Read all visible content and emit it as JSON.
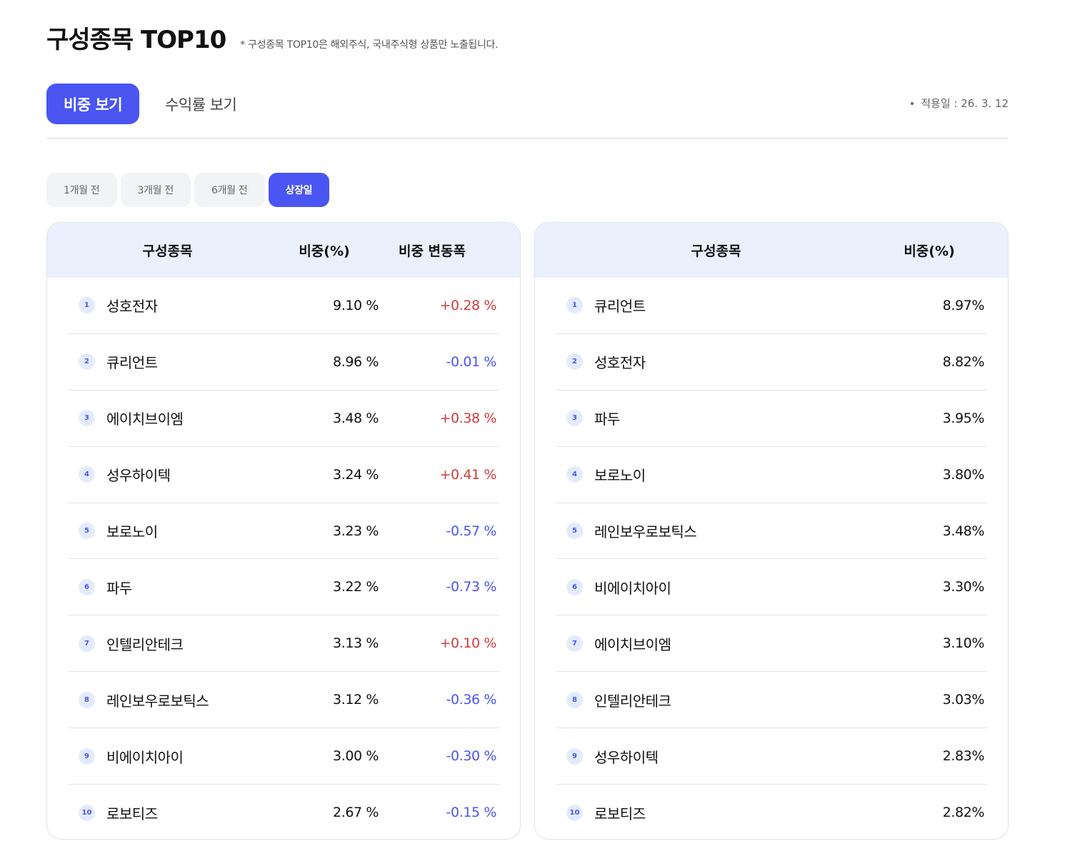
{
  "header": {
    "title": "구성종목 TOP10",
    "note": "* 구성종목 TOP10은 해외주식, 국내주식형 상품만 노출됩니다."
  },
  "view_tabs": [
    {
      "label": "비중 보기",
      "active": true
    },
    {
      "label": "수익률 보기",
      "active": false
    }
  ],
  "apply_date": "적용일 : 26. 3. 12",
  "period_tabs": [
    {
      "label": "1개월 전",
      "active": false
    },
    {
      "label": "3개월 전",
      "active": false
    },
    {
      "label": "6개월 전",
      "active": false
    },
    {
      "label": "상장일",
      "active": true
    }
  ],
  "left_table": {
    "headers": [
      "구성종목",
      "비중(%)",
      "비중 변동폭"
    ],
    "rows": [
      {
        "rank": "1",
        "name": "성호전자",
        "weight": "9.10 %",
        "change": "+0.28 %",
        "dir": "up"
      },
      {
        "rank": "2",
        "name": "큐리언트",
        "weight": "8.96 %",
        "change": "-0.01 %",
        "dir": "down"
      },
      {
        "rank": "3",
        "name": "에이치브이엠",
        "weight": "3.48 %",
        "change": "+0.38 %",
        "dir": "up"
      },
      {
        "rank": "4",
        "name": "성우하이텍",
        "weight": "3.24 %",
        "change": "+0.41 %",
        "dir": "up"
      },
      {
        "rank": "5",
        "name": "보로노이",
        "weight": "3.23 %",
        "change": "-0.57 %",
        "dir": "down"
      },
      {
        "rank": "6",
        "name": "파두",
        "weight": "3.22 %",
        "change": "-0.73 %",
        "dir": "down"
      },
      {
        "rank": "7",
        "name": "인텔리안테크",
        "weight": "3.13 %",
        "change": "+0.10 %",
        "dir": "up"
      },
      {
        "rank": "8",
        "name": "레인보우로보틱스",
        "weight": "3.12 %",
        "change": "-0.36 %",
        "dir": "down"
      },
      {
        "rank": "9",
        "name": "비에이치아이",
        "weight": "3.00 %",
        "change": "-0.30 %",
        "dir": "down"
      },
      {
        "rank": "10",
        "name": "로보티즈",
        "weight": "2.67 %",
        "change": "-0.15 %",
        "dir": "down"
      }
    ]
  },
  "right_table": {
    "headers": [
      "구성종목",
      "비중(%)"
    ],
    "rows": [
      {
        "rank": "1",
        "name": "큐리언트",
        "weight": "8.97%"
      },
      {
        "rank": "2",
        "name": "성호전자",
        "weight": "8.82%"
      },
      {
        "rank": "3",
        "name": "파두",
        "weight": "3.95%"
      },
      {
        "rank": "4",
        "name": "보로노이",
        "weight": "3.80%"
      },
      {
        "rank": "5",
        "name": "레인보우로보틱스",
        "weight": "3.48%"
      },
      {
        "rank": "6",
        "name": "비에이치아이",
        "weight": "3.30%"
      },
      {
        "rank": "7",
        "name": "에이치브이엠",
        "weight": "3.10%"
      },
      {
        "rank": "8",
        "name": "인텔리안테크",
        "weight": "3.03%"
      },
      {
        "rank": "9",
        "name": "성우하이텍",
        "weight": "2.83%"
      },
      {
        "rank": "10",
        "name": "로보티즈",
        "weight": "2.82%"
      }
    ]
  },
  "colors": {
    "accent": "#4a55f2",
    "up": "#d53a3a",
    "down": "#4a55f2",
    "table_header_bg": "#eaf1fc"
  }
}
